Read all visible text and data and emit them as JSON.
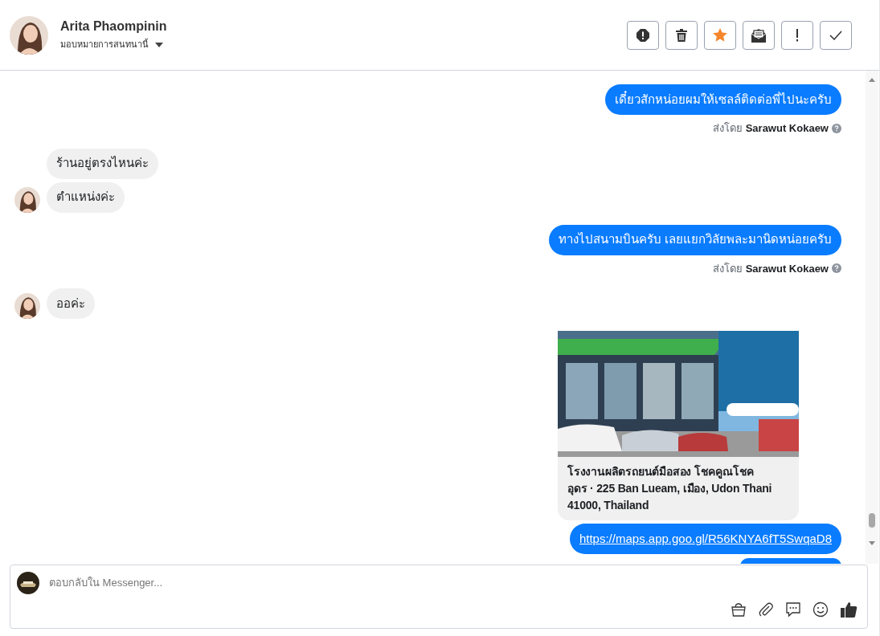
{
  "header": {
    "name": "Arita Phaompinin",
    "assign_label": "มอบหมายการสนทนานี้"
  },
  "actions": [
    {
      "kind": "alert"
    },
    {
      "kind": "trash"
    },
    {
      "kind": "star"
    },
    {
      "kind": "mail"
    },
    {
      "kind": "exclaim"
    },
    {
      "kind": "check"
    }
  ],
  "messages": [
    {
      "kind": "out",
      "text": "เดี๋ยวสักหน่อยผมให้เซลล์ติดต่อพี่ไปนะครับ",
      "sent_by_label": "ส่งโดย",
      "sender": "Sarawut Kokaew"
    },
    {
      "kind": "in",
      "text": "ร้านอยู่ตรงไหนค่ะ",
      "avatar": false
    },
    {
      "kind": "in",
      "text": "ตำแหน่งค่ะ",
      "avatar": true
    },
    {
      "kind": "out",
      "text": "ทางไปสนามบินครับ เลยแยกวิลัยพละมานิดหน่อยครับ",
      "sent_by_label": "ส่งโดย",
      "sender": "Sarawut Kokaew"
    },
    {
      "kind": "in",
      "text": "ออค่ะ",
      "avatar": true
    },
    {
      "kind": "card",
      "text": "โรงงานผลิตรถยนต์มือสอง โชคคูณโชค อุดร · 225 Ban Lueam, เมือง, Udon Thani 41000, Thailand"
    },
    {
      "kind": "link",
      "text": "https://maps.app.goo.gl/R56KNYA6fT5SwqaD8"
    }
  ],
  "composer": {
    "placeholder": "ตอบกลับใน Messenger...",
    "tools": [
      {
        "kind": "bag"
      },
      {
        "kind": "clip"
      },
      {
        "kind": "chat"
      },
      {
        "kind": "smile"
      },
      {
        "kind": "like"
      }
    ]
  }
}
